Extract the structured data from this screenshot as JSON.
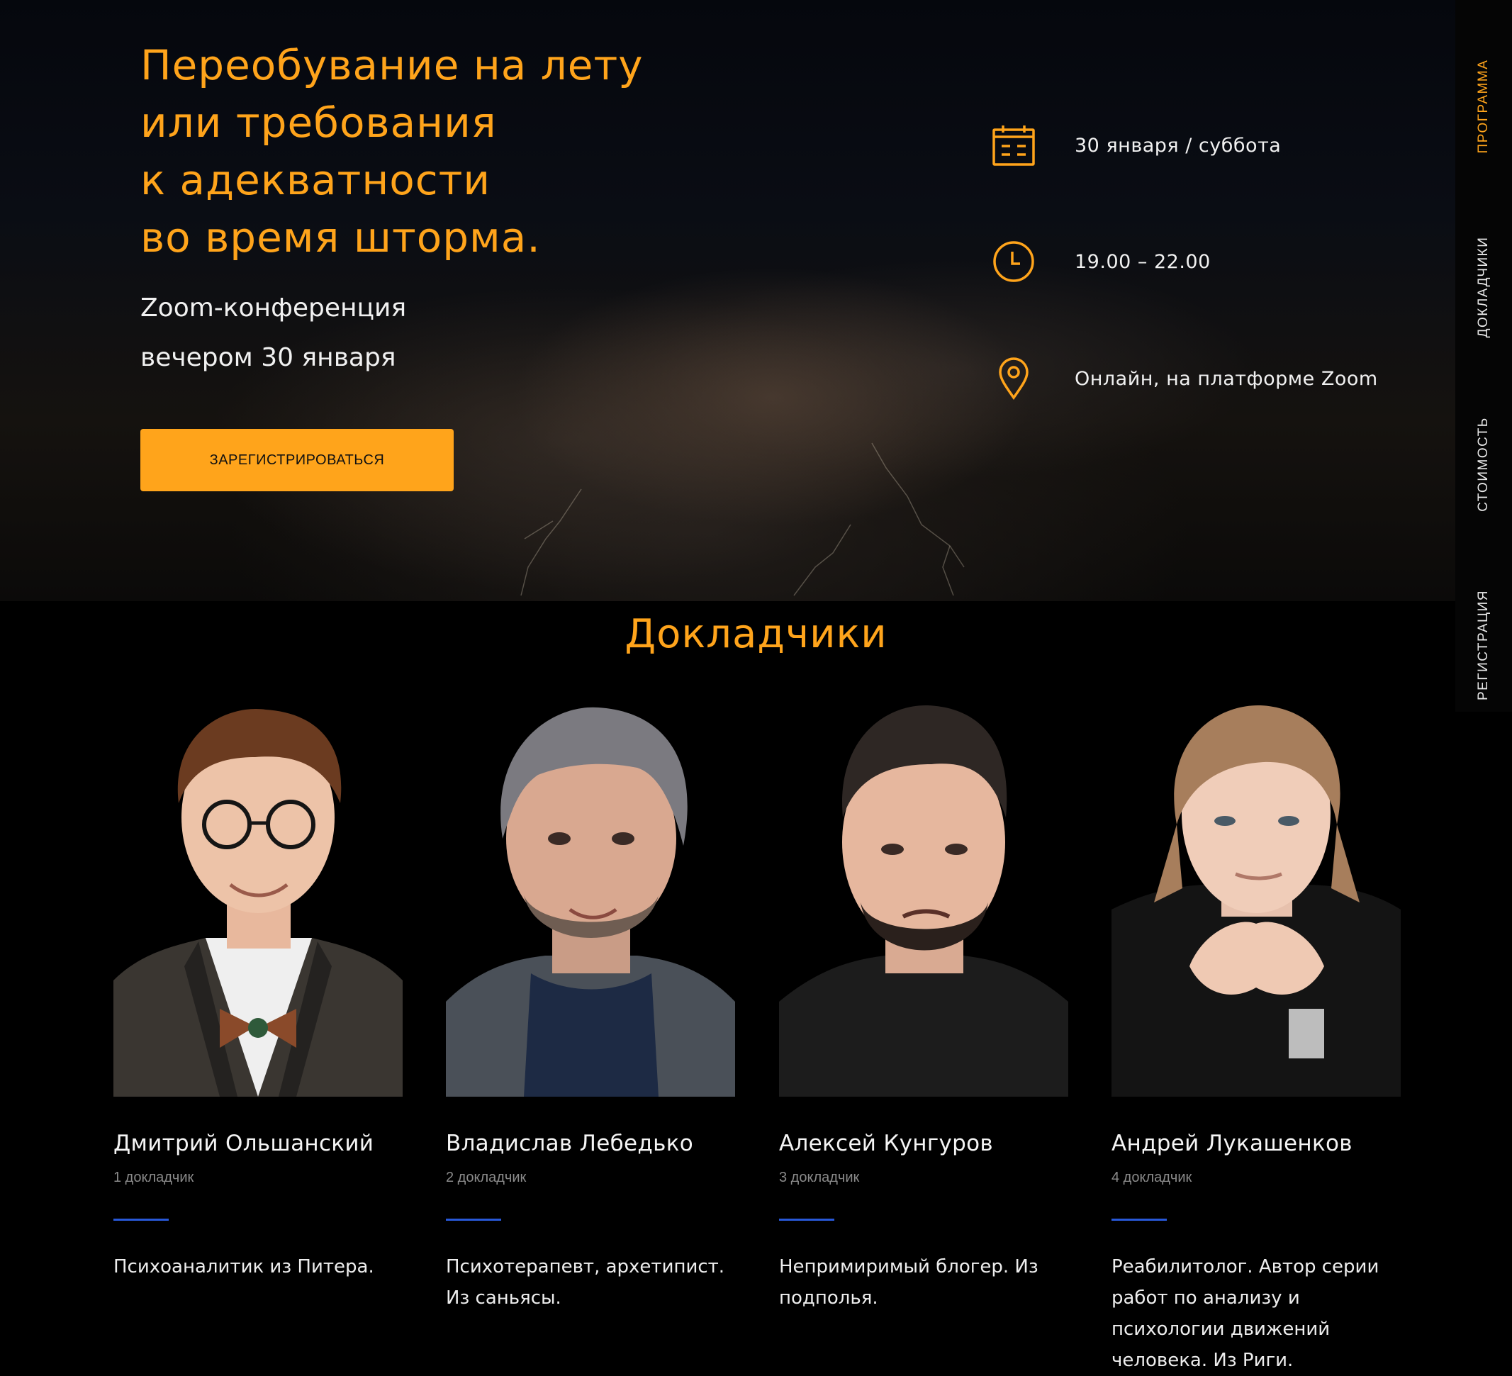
{
  "hero": {
    "title_lines": [
      "Переобувание на лету",
      "или требования",
      "к адекватности",
      "во время шторма."
    ],
    "subtitle_lines": [
      "Zoom-конференция",
      "вечером 30 января"
    ],
    "register_label": "ЗАРЕГИСТРИРОВАТЬСЯ",
    "info": [
      {
        "icon": "calendar-icon",
        "text": "30 января / суббота"
      },
      {
        "icon": "clock-icon",
        "text": "19.00 – 22.00"
      },
      {
        "icon": "location-pin-icon",
        "text": "Онлайн, на платформе Zoom"
      }
    ]
  },
  "side_nav": {
    "items": [
      "ПРОГРАММА",
      "ДОКЛАДЧИКИ",
      "СТОИМОСТЬ",
      "РЕГИСТРАЦИЯ"
    ],
    "active_index": 0
  },
  "speakers": {
    "title": "Докладчики",
    "items": [
      {
        "name": "Дмитрий Ольшанский",
        "role": "1 докладчик",
        "bio": "Психоаналитик из Питера."
      },
      {
        "name": "Владислав Лебедько",
        "role": "2 докладчик",
        "bio": "Психотерапевт, архетипист. Из саньясы."
      },
      {
        "name": "Алексей Кунгуров",
        "role": "3 докладчик",
        "bio": "Непримиримый блогер. Из подполья."
      },
      {
        "name": "Андрей Лукашенков",
        "role": "4 докладчик",
        "bio": "Реабилитолог. Автор серии работ по анализу и психологии движений человека. Из Риги."
      }
    ]
  },
  "colors": {
    "accent": "#ffa41b",
    "divider": "#2858d8",
    "background": "#000000"
  }
}
